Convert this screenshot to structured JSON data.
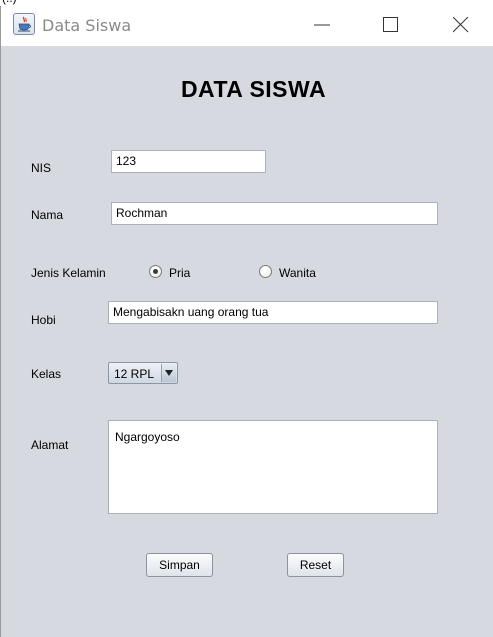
{
  "window": {
    "title": "Data Siswa"
  },
  "form": {
    "heading": "DATA SISWA",
    "nis": {
      "label": "NIS",
      "value": "123"
    },
    "nama": {
      "label": "Nama",
      "value": "Rochman"
    },
    "jenis_kelamin": {
      "label": "Jenis Kelamin",
      "options": [
        {
          "label": "Pria",
          "selected": true
        },
        {
          "label": "Wanita",
          "selected": false
        }
      ]
    },
    "hobi": {
      "label": "Hobi",
      "value": "Mengabisakn uang orang tua"
    },
    "kelas": {
      "label": "Kelas",
      "selected": "12 RPL"
    },
    "alamat": {
      "label": "Alamat",
      "value": "Ngargoyoso"
    },
    "buttons": {
      "save": "Simpan",
      "reset": "Reset"
    }
  },
  "colors": {
    "window_bg": "#d6d9df",
    "titlebar_bg": "#ffffff",
    "title_text": "#8a8a8a"
  },
  "icons": [
    "java-cup-icon",
    "minimize-icon",
    "maximize-icon",
    "close-icon",
    "dropdown-arrow-icon"
  ]
}
